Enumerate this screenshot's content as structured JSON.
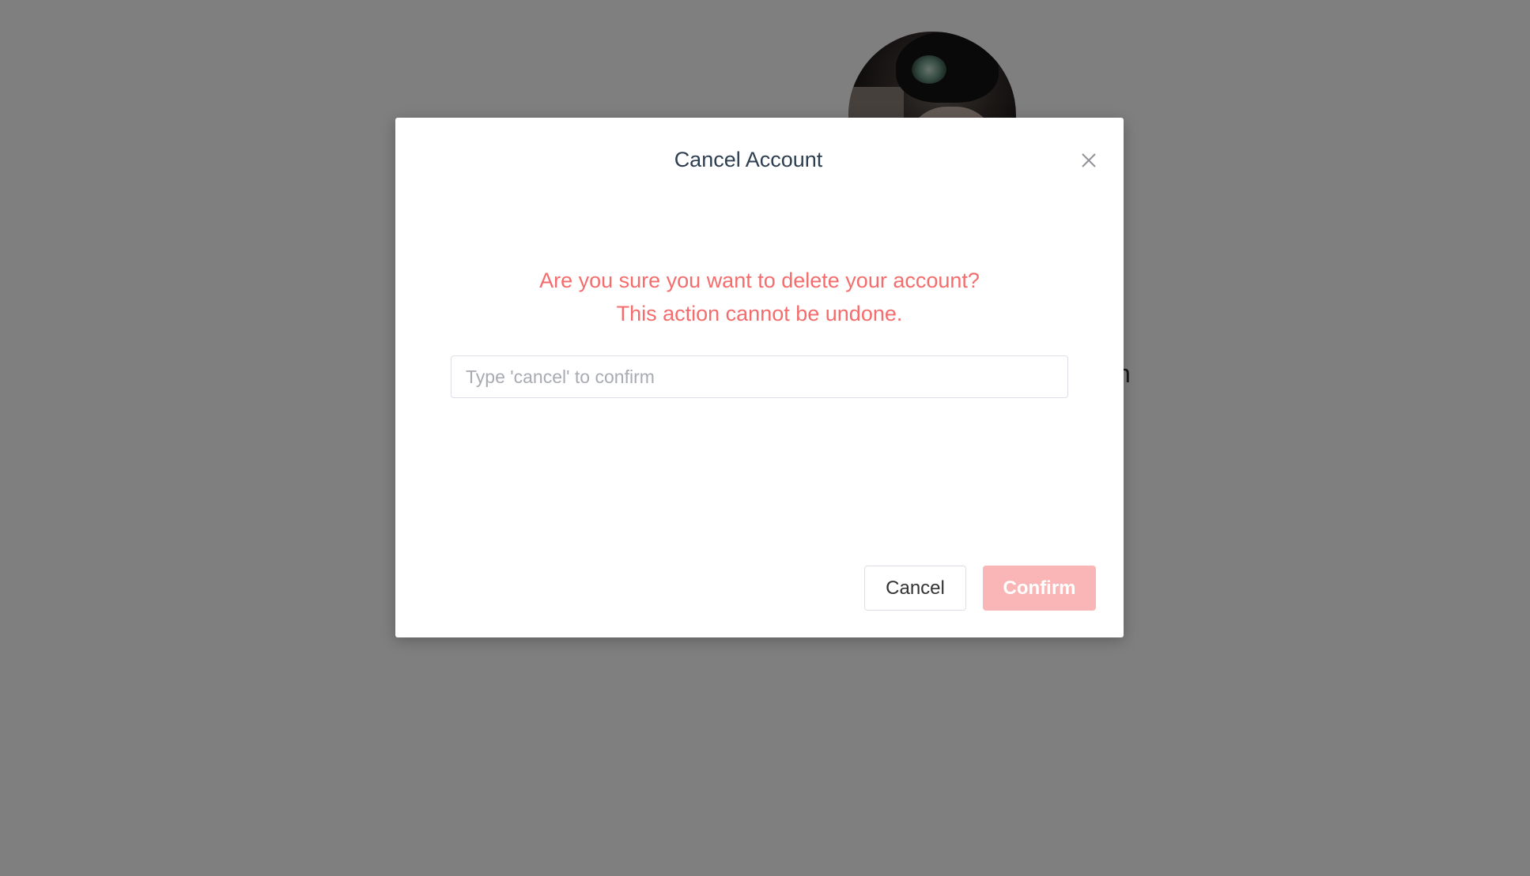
{
  "background": {
    "partial_text": "n"
  },
  "modal": {
    "title": "Cancel Account",
    "warning_line1": "Are you sure you want to delete your account?",
    "warning_line2": "This action cannot be undone.",
    "input": {
      "value": "",
      "placeholder": "Type 'cancel' to confirm"
    },
    "buttons": {
      "cancel_label": "Cancel",
      "confirm_label": "Confirm"
    },
    "close_icon": "close-icon"
  },
  "colors": {
    "warning": "#f56c6c",
    "confirm_disabled": "#fab6b6",
    "overlay": "rgba(0,0,0,0.5)"
  }
}
